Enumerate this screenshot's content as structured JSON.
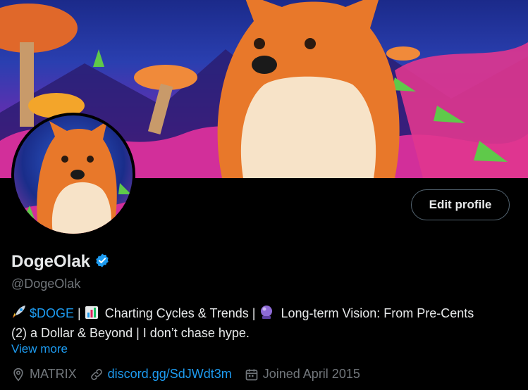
{
  "profile": {
    "name": "DogeOlak",
    "handle": "@DogeOlak",
    "edit_label": "Edit profile",
    "bio": {
      "ticker": "$DOGE",
      "sep1": " | ",
      "charting": " Charting Cycles & Trends | ",
      "vision": " Long-term Vision: From Pre-Cents",
      "line2": "(2) a  Dollar & Beyond | I don’t chase hype."
    },
    "view_more": "View more",
    "location": "MATRIX",
    "url": "discord.gg/SdJWdt3m",
    "joined": "Joined April 2015"
  },
  "icons": {
    "verified": "verified-badge-icon",
    "rocket": "rocket-icon",
    "chart": "bar-chart-icon",
    "crystal": "crystal-ball-icon",
    "location": "location-pin-icon",
    "link": "link-icon",
    "calendar": "calendar-icon"
  },
  "colors": {
    "accent": "#1d9bf0",
    "muted": "#71767b",
    "text": "#e7e9ea",
    "background": "#000000"
  }
}
